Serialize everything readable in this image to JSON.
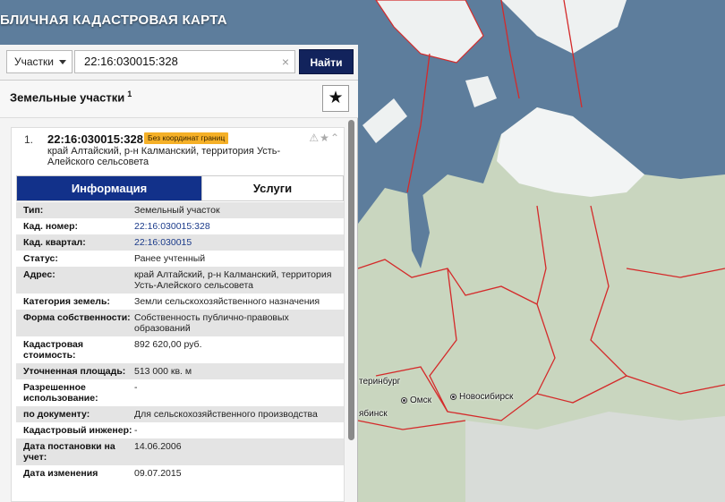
{
  "app": {
    "title": "БЛИЧНАЯ КАДАСТРОВАЯ КАРТА"
  },
  "search": {
    "type_label": "Участки",
    "query": "22:16:030015:328",
    "clear_symbol": "×",
    "button_label": "Найти"
  },
  "panel": {
    "title": "Земельные участки",
    "count": "1",
    "favorite_symbol": "★"
  },
  "result": {
    "index": "1.",
    "cad_number": "22:16:030015:328",
    "badge": "Без координат границ",
    "actions": "⚠★⌃",
    "address": "край Алтайский, р-н Калманский, территория Усть-Алейского сельсовета"
  },
  "tabs": {
    "info": "Информация",
    "services": "Услуги"
  },
  "properties": [
    {
      "label": "Тип:",
      "value": "Земельный участок"
    },
    {
      "label": "Кад. номер:",
      "value": "22:16:030015:328",
      "link": true
    },
    {
      "label": "Кад. квартал:",
      "value": "22:16:030015",
      "link": true
    },
    {
      "label": "Статус:",
      "value": "Ранее учтенный"
    },
    {
      "label": "Адрес:",
      "value": "край Алтайский, р-н Калманский, территория Усть-Алейского сельсовета"
    },
    {
      "label": "Категория земель:",
      "value": "Земли сельскохозяйственного назначения"
    },
    {
      "label": "Форма собственности:",
      "value": "Собственность публично-правовых образований"
    },
    {
      "label": "Кадастровая стоимость:",
      "value": "892 620,00 руб."
    },
    {
      "label": "Уточненная площадь:",
      "value": "513 000 кв. м"
    },
    {
      "label": "Разрешенное использование:",
      "value": "-"
    },
    {
      "label": "по документу:",
      "value": "Для сельскохозяйственного производства"
    },
    {
      "label": "Кадастровый инженер:",
      "value": "-"
    },
    {
      "label": "Дата постановки на учет:",
      "value": "14.06.2006"
    },
    {
      "label": "Дата изменения",
      "value": "09.07.2015"
    }
  ],
  "map": {
    "cities": [
      {
        "name": "теринбург",
        "dot": false
      },
      {
        "name": "Омск",
        "dot": true
      },
      {
        "name": "Новосибирск",
        "dot": true
      },
      {
        "name": "ябинск",
        "dot": false
      }
    ]
  },
  "colors": {
    "sea": "#5d7d9c",
    "land": "#c9d6bf",
    "ice": "#f2f4f4",
    "border": "#d42a2a",
    "accent": "#12318a",
    "button": "#12235c",
    "badge": "#f5b027"
  }
}
